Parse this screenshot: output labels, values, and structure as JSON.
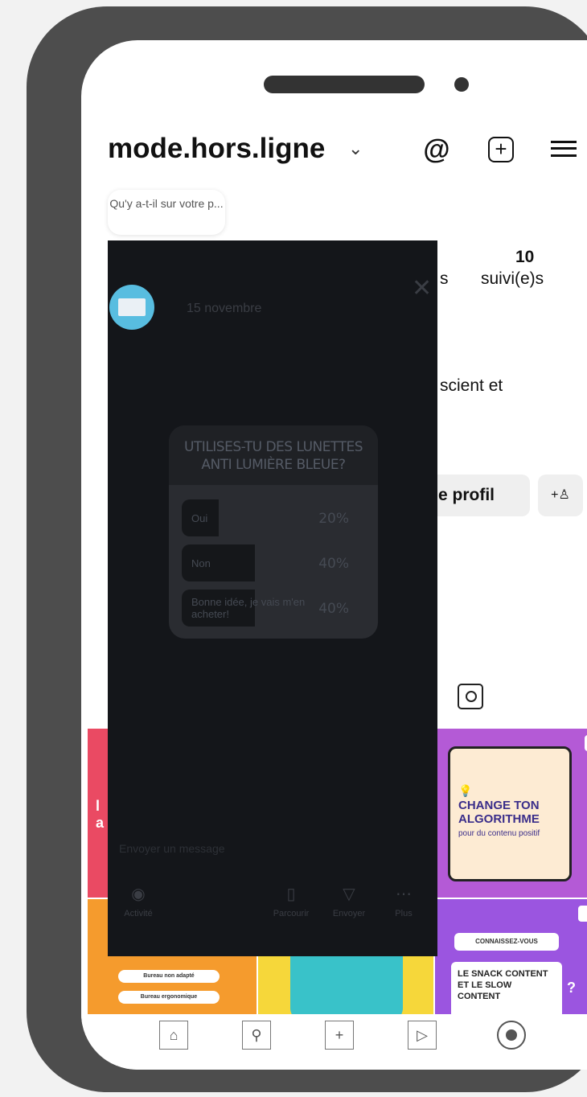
{
  "profile": {
    "username": "mode.hors.ligne",
    "note": "Qu'y a-t-il sur votre p...",
    "following_count": "10",
    "following_label": "suivi(e)s",
    "followers_label_partial": "s",
    "bio_partial": "scient et",
    "edit_profile_partial": "e profil"
  },
  "header_icons": [
    "threads-icon",
    "add-post-icon",
    "menu-icon"
  ],
  "grid": {
    "post3": {
      "headline": "CHANGE TON ALGORITHME",
      "sub": "pour du contenu positif"
    },
    "post4": {
      "pill1": "Bureau non adapté",
      "pill2": "Bureau ergonomique"
    },
    "post6": {
      "tag": "CONNAISSEZ-VOUS",
      "text": "LE SNACK CONTENT ET LE SLOW CONTENT"
    }
  },
  "story": {
    "date": "15 novembre",
    "poll": {
      "question": "UTILISES-TU DES LUNETTES ANTI LUMIÈRE BLEUE?",
      "options": [
        {
          "label": "Oui",
          "pct_label": "20%",
          "pct": 20
        },
        {
          "label": "Non",
          "pct_label": "40%",
          "pct": 40
        },
        {
          "label": "Bonne idée, je vais m'en acheter!",
          "pct_label": "40%",
          "pct": 40
        }
      ]
    },
    "reply_placeholder": "Envoyer un message",
    "actions": [
      "Activité",
      "Parcourir",
      "Envoyer",
      "Plus"
    ]
  },
  "bottom_nav": [
    "home-icon",
    "search-icon",
    "create-icon",
    "reels-icon",
    "profile-icon"
  ],
  "colors": {
    "phone_frame": "#4d4d4d",
    "story_bg": "#14161a",
    "avatar": "#58bde0"
  }
}
